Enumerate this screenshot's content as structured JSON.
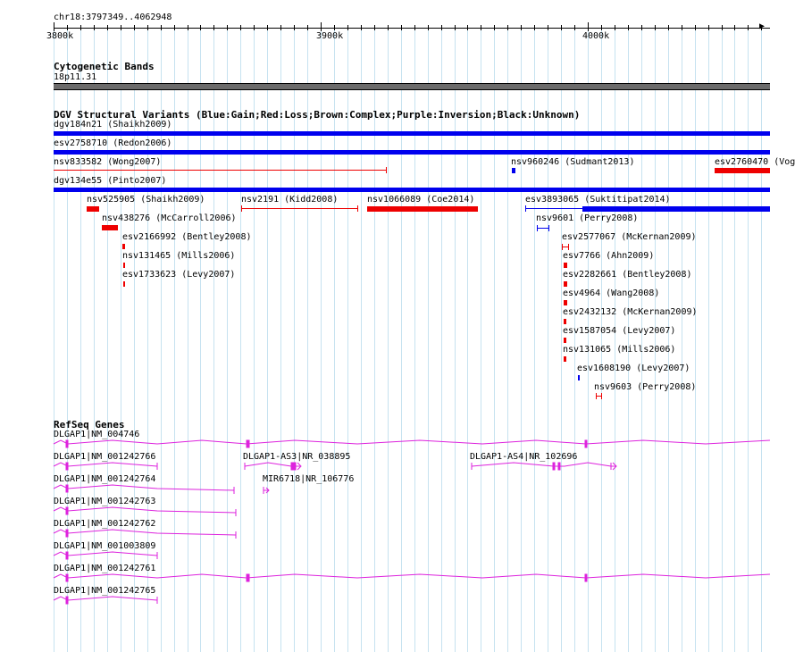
{
  "ruler": {
    "location": "chr18:3797349..4062948",
    "major_labels": [
      "3800k",
      "3900k",
      "4000k"
    ]
  },
  "tracks": {
    "cytoband": {
      "title": "Cytogenetic Bands",
      "band": "18p11.31",
      "color": "#6b6b6b"
    },
    "dgv": {
      "title": "DGV Structural Variants (Blue:Gain;Red:Loss;Brown:Complex;Purple:Inversion;Black:Unknown)",
      "legend_colors": {
        "gain": "#0000ee",
        "loss": "#ee0000",
        "complex": "#8b4513",
        "inversion": "#800080",
        "unknown": "#000000"
      },
      "features": [
        "dgv184n21 (Shaikh2009)",
        "esv2758710 (Redon2006)",
        "nsv833582 (Wong2007)",
        "nsv960246 (Sudmant2013)",
        "esv2760470 (Vog",
        "dgv134e55 (Pinto2007)",
        "nsv525905 (Shaikh2009)",
        "nsv2191 (Kidd2008)",
        "nsv1066089 (Coe2014)",
        "esv3893065 (Suktitipat2014)",
        "nsv438276 (McCarroll2006)",
        "nsv9601 (Perry2008)",
        "esv2166992 (Bentley2008)",
        "esv2577067 (McKernan2009)",
        "nsv131465 (Mills2006)",
        "esv7766 (Ahn2009)",
        "esv1733623 (Levy2007)",
        "esv2282661 (Bentley2008)",
        "esv4964 (Wang2008)",
        "esv2432132 (McKernan2009)",
        "esv1587054 (Levy2007)",
        "nsv131065 (Mills2006)",
        "esv1608190 (Levy2007)",
        "nsv9603 (Perry2008)"
      ]
    },
    "refseq": {
      "title": "RefSeq Genes",
      "color": "#dd22dd",
      "genes": [
        "DLGAP1|NM_004746",
        "DLGAP1|NM_001242766",
        "DLGAP1-AS3|NR_038895",
        "DLGAP1-AS4|NR_102696",
        "DLGAP1|NM_001242764",
        "MIR6718|NR_106776",
        "DLGAP1|NM_001242763",
        "DLGAP1|NM_001242762",
        "DLGAP1|NM_001003809",
        "DLGAP1|NM_001242761",
        "DLGAP1|NM_001242765"
      ]
    }
  }
}
